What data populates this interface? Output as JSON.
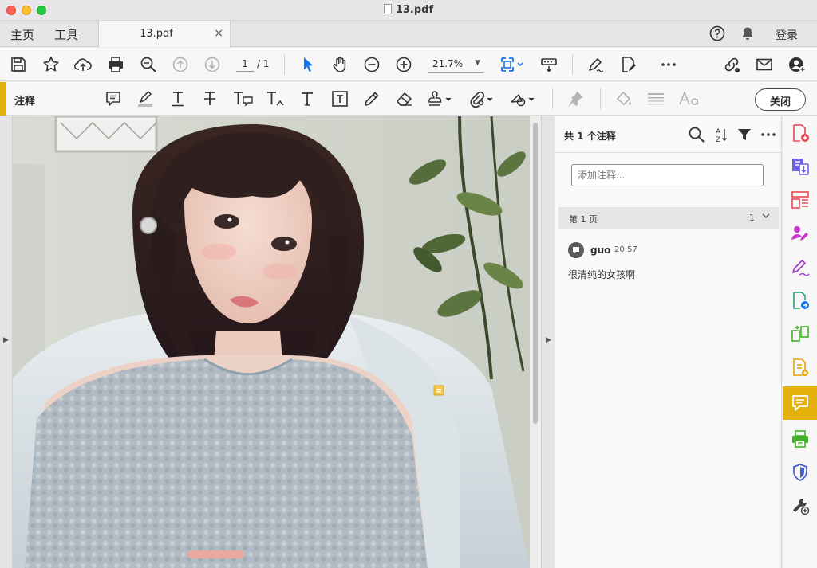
{
  "window": {
    "title": "13.pdf"
  },
  "tabbar": {
    "home": "主页",
    "tools": "工具",
    "doc_tab": "13.pdf",
    "close_tab": "×",
    "login": "登录"
  },
  "toolbar": {
    "page_current": "1",
    "page_total": "/ 1",
    "zoom": "21.7%"
  },
  "comment_toolbar": {
    "mode_label": "注释",
    "close_label": "关闭"
  },
  "comments_panel": {
    "count_label": "共 1 个注释",
    "add_placeholder": "添加注释...",
    "page_group": {
      "label": "第 1 页",
      "count": "1"
    },
    "items": [
      {
        "author": "guo",
        "time": "20:57",
        "text": "很清纯的女孩啊"
      }
    ]
  },
  "colors": {
    "accent": "#e5b10c",
    "active_tool": "#1473e6"
  }
}
